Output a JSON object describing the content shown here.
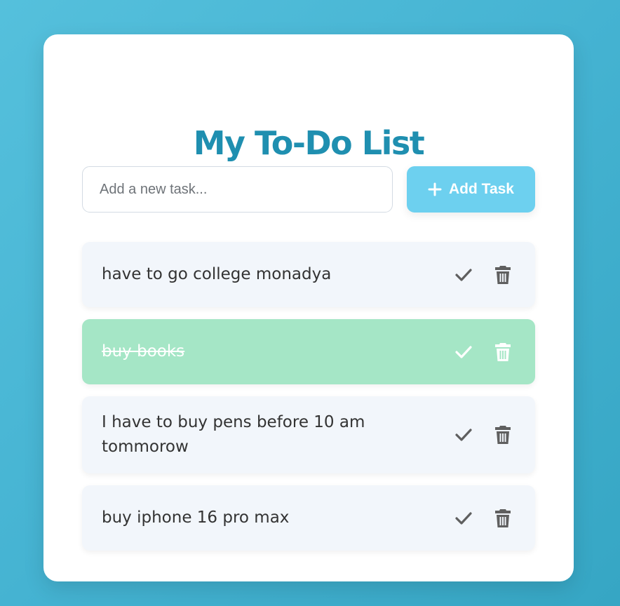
{
  "header": {
    "title": "My To-Do List"
  },
  "new_task": {
    "placeholder": "Add a new task...",
    "value": ""
  },
  "add_button": {
    "label": "Add Task",
    "icon": "plus-icon"
  },
  "tasks": [
    {
      "text": "have to go college monadya",
      "completed": false
    },
    {
      "text": "buy books",
      "completed": true
    },
    {
      "text": "I have to buy pens before 10 am tommorow",
      "completed": false
    },
    {
      "text": "buy iphone 16 pro max",
      "completed": false
    }
  ],
  "colors": {
    "background": "#45b3d2",
    "title": "#1f8fb0",
    "button": "#6dd0ef",
    "item_bg": "#f2f6fb",
    "completed_bg": "#a5e6c6",
    "icon": "#5f5f5f"
  }
}
